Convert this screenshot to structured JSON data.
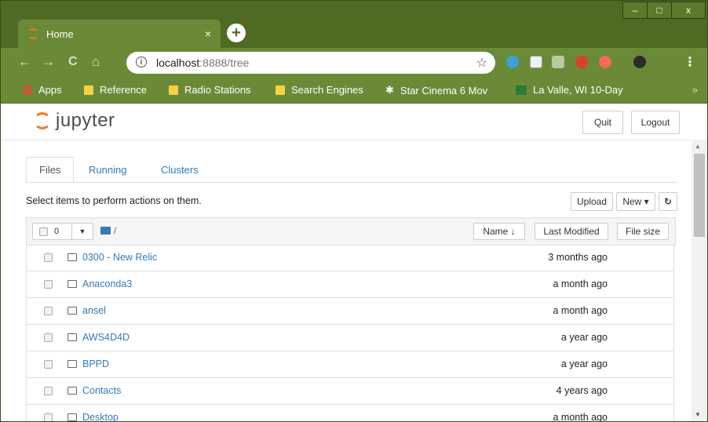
{
  "browser": {
    "tab_title": "Home",
    "tab_close": "×",
    "new_tab": "+",
    "window_controls": {
      "minimize": "–",
      "maximize": "□",
      "close": "x"
    },
    "nav": {
      "back": "←",
      "forward": "→",
      "reload": "C",
      "home": "⌂"
    },
    "url_host": "localhost",
    "url_path": ":8888/tree",
    "bookmark_star": "☆",
    "menu": "⋮",
    "bookmarks": [
      {
        "label": "Apps"
      },
      {
        "label": "Reference"
      },
      {
        "label": "Radio Stations"
      },
      {
        "label": "Search Engines"
      },
      {
        "label": "Star Cinema 6 Mov"
      },
      {
        "label": "La Valle, WI 10-Day"
      }
    ],
    "bookmarks_more": "»"
  },
  "jupyter": {
    "logo_text": "jupyter",
    "quit_label": "Quit",
    "logout_label": "Logout",
    "tabs": [
      {
        "label": "Files"
      },
      {
        "label": "Running"
      },
      {
        "label": "Clusters"
      }
    ],
    "hint": "Select items to perform actions on them.",
    "upload_label": "Upload",
    "new_label": "New ▾",
    "refresh_label": "↻",
    "list": {
      "selected_count": "0",
      "caret": "▼",
      "breadcrumb": "/",
      "name_header": "Name ↓",
      "modified_header": "Last Modified",
      "size_header": "File size",
      "rows": [
        {
          "name": "0300 - New Relic",
          "modified": "3 months ago"
        },
        {
          "name": "Anaconda3",
          "modified": "a month ago"
        },
        {
          "name": "ansel",
          "modified": "a month ago"
        },
        {
          "name": "AWS4D4D",
          "modified": "a year ago"
        },
        {
          "name": "BPPD",
          "modified": "a year ago"
        },
        {
          "name": "Contacts",
          "modified": "4 years ago"
        },
        {
          "name": "Desktop",
          "modified": "a month ago"
        }
      ]
    }
  },
  "colors": {
    "chrome_frame": "#4e6a23",
    "chrome_tab": "#6b8a38",
    "jupyter_orange": "#f37626",
    "link_blue": "#337ab7"
  }
}
